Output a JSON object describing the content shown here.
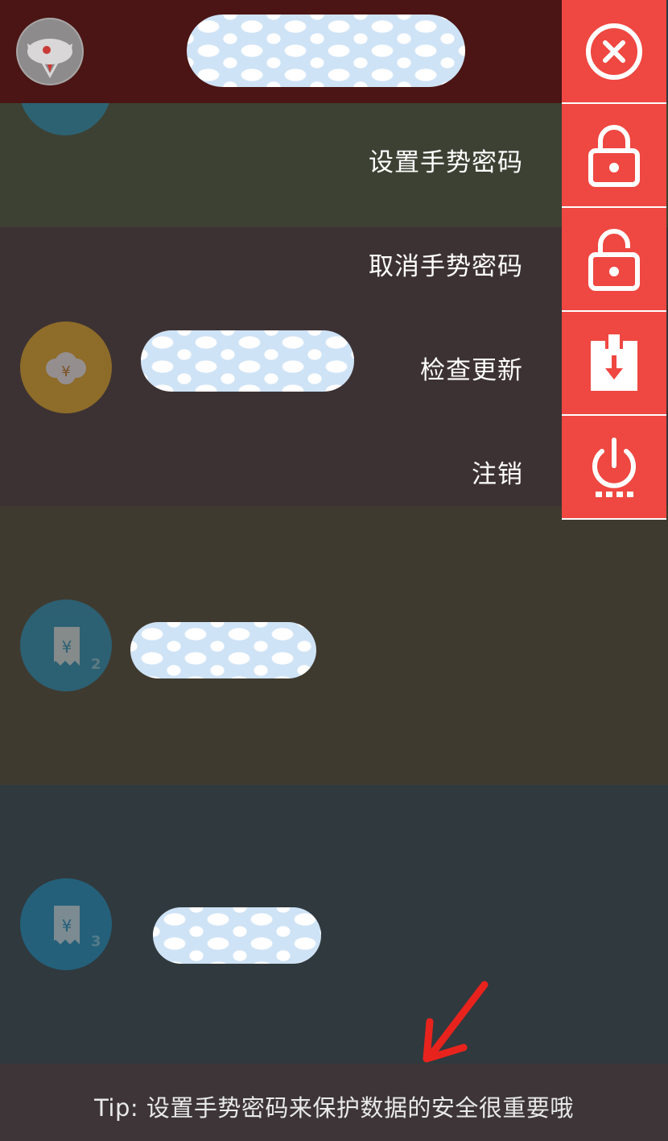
{
  "menu": {
    "items": [
      {
        "label": "设置手势密码",
        "icon": "lock-icon"
      },
      {
        "label": "取消手势密码",
        "icon": "unlock-icon"
      },
      {
        "label": "检查更新",
        "icon": "download-update-icon"
      },
      {
        "label": "注销",
        "icon": "power-icon"
      }
    ],
    "close_icon": "close-icon"
  },
  "list": {
    "items": [
      {
        "icon": "cotton-yuan-icon",
        "badge": ""
      },
      {
        "icon": "receipt-yuan-icon",
        "badge": "2"
      },
      {
        "icon": "receipt-yuan-icon",
        "badge": "3"
      }
    ]
  },
  "tip": {
    "text": "Tip: 设置手势密码来保护数据的安全很重要哦"
  },
  "colors": {
    "accent": "#ef4741",
    "header": "#4a1514",
    "annotation_arrow": "#e8231d"
  }
}
